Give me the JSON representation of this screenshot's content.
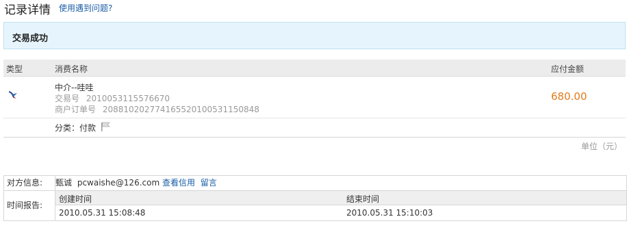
{
  "header": {
    "title": "记录详情",
    "help_link": "使用遇到问题?"
  },
  "status": {
    "text": "交易成功"
  },
  "table": {
    "col_type": "类型",
    "col_name": "消费名称",
    "col_amount": "应付金额",
    "row": {
      "icon": "bird-icon",
      "name": "中介--哇哇",
      "trade_no_label": "交易号",
      "trade_no": "2010053115576670",
      "order_no_label": "商户订单号",
      "order_no": "20881020277416552010053115084​8",
      "amount": "680.00",
      "category_label": "分类：",
      "category": "付款",
      "flag_icon": "flag-icon"
    },
    "unit_note": "单位（元）"
  },
  "counterpart": {
    "label": "对方信息:",
    "name": "甄诚",
    "email": "pcwaishe@126.com",
    "credit_link": "查看信用",
    "message_link": "留言"
  },
  "time_report": {
    "label": "时间报告:",
    "created_label": "创建时间",
    "created": "2010.05.31 15:08:48",
    "ended_label": "结束时间",
    "ended": "2010.05.31 15:10:03"
  },
  "colors": {
    "amount": "#e27a1b",
    "link": "#1a5ea6",
    "status_bg": "#e6f5fd"
  }
}
